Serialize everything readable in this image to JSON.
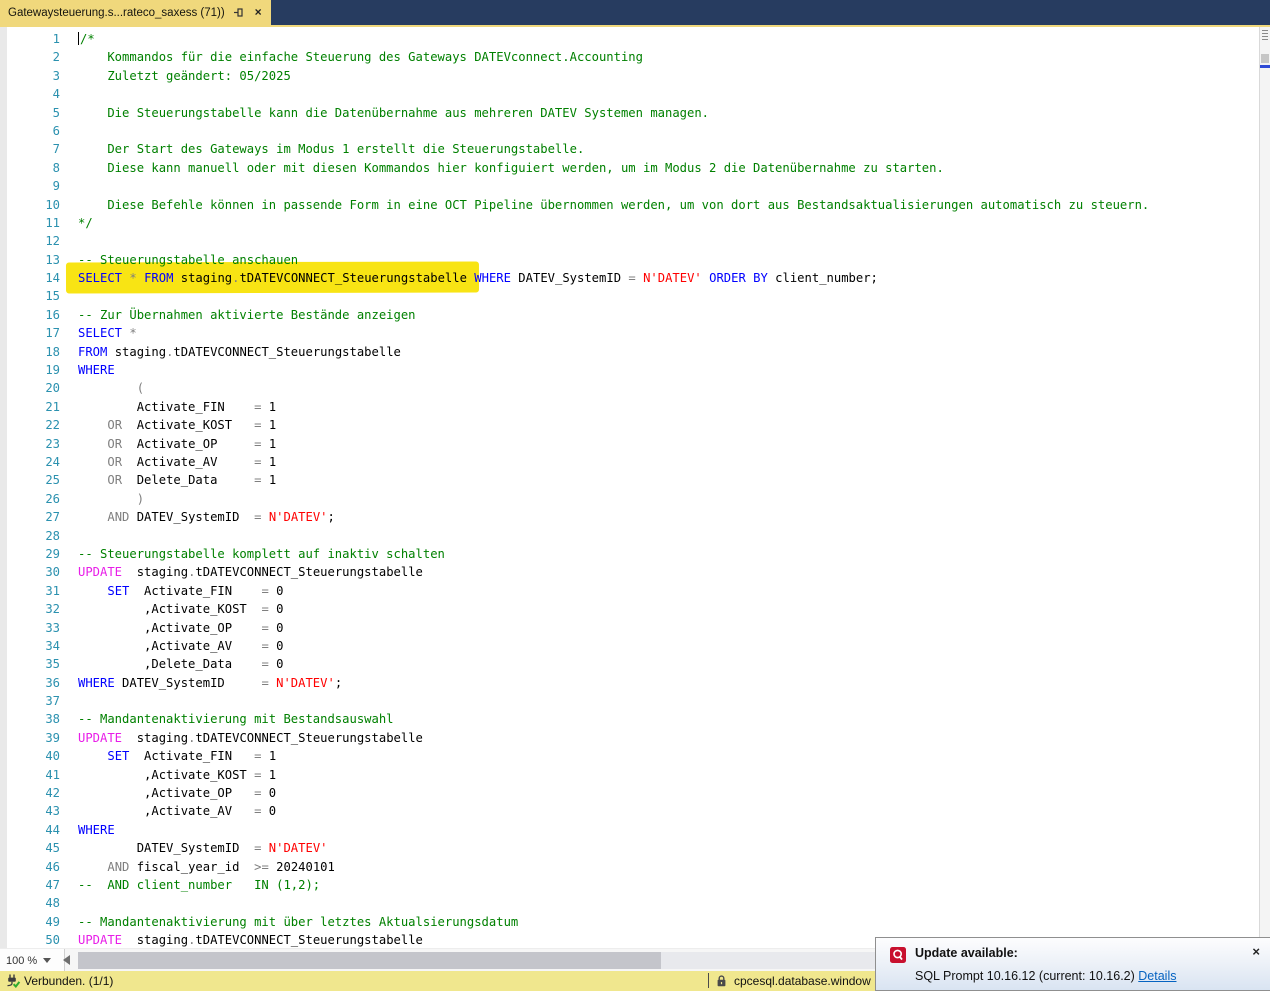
{
  "colors": {
    "navy": "#273c60",
    "tab_gold": "#f0d87c",
    "lineno": "#2b91af",
    "cm": "#008000",
    "kw": "#0000ff",
    "op": "#7f7f7f",
    "mg": "#e81ee8",
    "str": "#ff0000",
    "idc": "#000000",
    "numc": "#000000",
    "status_bg": "#f0e78e",
    "track": "#e8e9ed",
    "thumb": "#c4c5cb",
    "scrollcol": "#f4f4f4",
    "link": "#0563c1"
  },
  "tab": {
    "title": "Gatewaysteuerung.s...rateco_saxess (71))",
    "close_glyph": "×"
  },
  "icons": {
    "pin": "pushpin",
    "chevron_down": "▾",
    "scroll_left_arrow": "◀",
    "connection_plug": "plug-with-green-check",
    "lock": "padlock",
    "sql_prompt": "red-speech-bubble"
  },
  "editor": {
    "zoom_level": "100 %",
    "highlight": {
      "color": "#f8e414",
      "lines": "13-14",
      "covers": "SELECT * FROM staging.tDATEVCONNECT_Steuerungstabelle"
    },
    "lines": [
      {
        "n": 1,
        "caret": true,
        "tokens": [
          [
            "cm",
            "/*"
          ]
        ]
      },
      {
        "n": 2,
        "tokens": [
          [
            "cm",
            "    Kommandos für die einfache Steuerung des Gateways DATEVconnect.Accounting"
          ]
        ]
      },
      {
        "n": 3,
        "tokens": [
          [
            "cm",
            "    Zuletzt geändert: 05/2025"
          ]
        ]
      },
      {
        "n": 4,
        "tokens": []
      },
      {
        "n": 5,
        "tokens": [
          [
            "cm",
            "    Die Steuerungstabelle kann die Datenübernahme aus mehreren DATEV Systemen managen."
          ]
        ]
      },
      {
        "n": 6,
        "tokens": []
      },
      {
        "n": 7,
        "tokens": [
          [
            "cm",
            "    Der Start des Gateways im Modus 1 erstellt die Steuerungstabelle."
          ]
        ]
      },
      {
        "n": 8,
        "tokens": [
          [
            "cm",
            "    Diese kann manuell oder mit diesen Kommandos hier konfiguiert werden, um im Modus 2 die Datenübernahme zu starten."
          ]
        ]
      },
      {
        "n": 9,
        "tokens": []
      },
      {
        "n": 10,
        "tokens": [
          [
            "cm",
            "    Diese Befehle können in passende Form in eine OCT Pipeline übernommen werden, um von dort aus Bestandsaktualisierungen automatisch zu steuern."
          ]
        ]
      },
      {
        "n": 11,
        "tokens": [
          [
            "cm",
            "*/"
          ]
        ]
      },
      {
        "n": 12,
        "tokens": []
      },
      {
        "n": 13,
        "tokens": [
          [
            "cm",
            "-- Steuerungstabelle anschauen"
          ]
        ]
      },
      {
        "n": 14,
        "tokens": [
          [
            "kw",
            "SELECT"
          ],
          [
            "id",
            " "
          ],
          [
            "op",
            "*"
          ],
          [
            "id",
            " "
          ],
          [
            "kw",
            "FROM"
          ],
          [
            "id",
            " staging"
          ],
          [
            "op",
            "."
          ],
          [
            "id",
            "tDATEVCONNECT_Steuerungstabelle "
          ],
          [
            "kw",
            "WHERE"
          ],
          [
            "id",
            " DATEV_SystemID "
          ],
          [
            "op",
            "="
          ],
          [
            "id",
            " "
          ],
          [
            "str",
            "N'DATEV'"
          ],
          [
            "id",
            " "
          ],
          [
            "kw",
            "ORDER"
          ],
          [
            "id",
            " "
          ],
          [
            "kw",
            "BY"
          ],
          [
            "id",
            " client_number;"
          ]
        ]
      },
      {
        "n": 15,
        "tokens": []
      },
      {
        "n": 16,
        "tokens": [
          [
            "cm",
            "-- Zur Übernahmen aktivierte Bestände anzeigen"
          ]
        ]
      },
      {
        "n": 17,
        "tokens": [
          [
            "kw",
            "SELECT"
          ],
          [
            "id",
            " "
          ],
          [
            "op",
            "*"
          ]
        ]
      },
      {
        "n": 18,
        "tokens": [
          [
            "kw",
            "FROM"
          ],
          [
            "id",
            " staging"
          ],
          [
            "op",
            "."
          ],
          [
            "id",
            "tDATEVCONNECT_Steuerungstabelle"
          ]
        ]
      },
      {
        "n": 19,
        "tokens": [
          [
            "kw",
            "WHERE"
          ]
        ]
      },
      {
        "n": 20,
        "tokens": [
          [
            "id",
            "        "
          ],
          [
            "op",
            "("
          ]
        ]
      },
      {
        "n": 21,
        "tokens": [
          [
            "id",
            "        Activate_FIN    "
          ],
          [
            "op",
            "="
          ],
          [
            "id",
            " "
          ],
          [
            "num",
            "1"
          ]
        ]
      },
      {
        "n": 22,
        "tokens": [
          [
            "id",
            "    "
          ],
          [
            "op",
            "OR"
          ],
          [
            "id",
            "  Activate_KOST   "
          ],
          [
            "op",
            "="
          ],
          [
            "id",
            " "
          ],
          [
            "num",
            "1"
          ]
        ]
      },
      {
        "n": 23,
        "tokens": [
          [
            "id",
            "    "
          ],
          [
            "op",
            "OR"
          ],
          [
            "id",
            "  Activate_OP     "
          ],
          [
            "op",
            "="
          ],
          [
            "id",
            " "
          ],
          [
            "num",
            "1"
          ]
        ]
      },
      {
        "n": 24,
        "tokens": [
          [
            "id",
            "    "
          ],
          [
            "op",
            "OR"
          ],
          [
            "id",
            "  Activate_AV     "
          ],
          [
            "op",
            "="
          ],
          [
            "id",
            " "
          ],
          [
            "num",
            "1"
          ]
        ]
      },
      {
        "n": 25,
        "tokens": [
          [
            "id",
            "    "
          ],
          [
            "op",
            "OR"
          ],
          [
            "id",
            "  Delete_Data     "
          ],
          [
            "op",
            "="
          ],
          [
            "id",
            " "
          ],
          [
            "num",
            "1"
          ]
        ]
      },
      {
        "n": 26,
        "tokens": [
          [
            "id",
            "        "
          ],
          [
            "op",
            ")"
          ]
        ]
      },
      {
        "n": 27,
        "tokens": [
          [
            "id",
            "    "
          ],
          [
            "op",
            "AND"
          ],
          [
            "id",
            " DATEV_SystemID  "
          ],
          [
            "op",
            "="
          ],
          [
            "id",
            " "
          ],
          [
            "str",
            "N'DATEV'"
          ],
          [
            "id",
            ";"
          ]
        ]
      },
      {
        "n": 28,
        "tokens": []
      },
      {
        "n": 29,
        "tokens": [
          [
            "cm",
            "-- Steuerungstabelle komplett auf inaktiv schalten"
          ]
        ]
      },
      {
        "n": 30,
        "tokens": [
          [
            "mg",
            "UPDATE"
          ],
          [
            "id",
            "  staging"
          ],
          [
            "op",
            "."
          ],
          [
            "id",
            "tDATEVCONNECT_Steuerungstabelle"
          ]
        ]
      },
      {
        "n": 31,
        "tokens": [
          [
            "id",
            "    "
          ],
          [
            "kw",
            "SET"
          ],
          [
            "id",
            "  Activate_FIN    "
          ],
          [
            "op",
            "="
          ],
          [
            "id",
            " "
          ],
          [
            "num",
            "0"
          ]
        ]
      },
      {
        "n": 32,
        "tokens": [
          [
            "id",
            "         ,Activate_KOST  "
          ],
          [
            "op",
            "="
          ],
          [
            "id",
            " "
          ],
          [
            "num",
            "0"
          ]
        ]
      },
      {
        "n": 33,
        "tokens": [
          [
            "id",
            "         ,Activate_OP    "
          ],
          [
            "op",
            "="
          ],
          [
            "id",
            " "
          ],
          [
            "num",
            "0"
          ]
        ]
      },
      {
        "n": 34,
        "tokens": [
          [
            "id",
            "         ,Activate_AV    "
          ],
          [
            "op",
            "="
          ],
          [
            "id",
            " "
          ],
          [
            "num",
            "0"
          ]
        ]
      },
      {
        "n": 35,
        "tokens": [
          [
            "id",
            "         ,Delete_Data    "
          ],
          [
            "op",
            "="
          ],
          [
            "id",
            " "
          ],
          [
            "num",
            "0"
          ]
        ]
      },
      {
        "n": 36,
        "tokens": [
          [
            "kw",
            "WHERE"
          ],
          [
            "id",
            " DATEV_SystemID     "
          ],
          [
            "op",
            "="
          ],
          [
            "id",
            " "
          ],
          [
            "str",
            "N'DATEV'"
          ],
          [
            "id",
            ";"
          ]
        ]
      },
      {
        "n": 37,
        "tokens": []
      },
      {
        "n": 38,
        "tokens": [
          [
            "cm",
            "-- Mandantenaktivierung mit Bestandsauswahl"
          ]
        ]
      },
      {
        "n": 39,
        "tokens": [
          [
            "mg",
            "UPDATE"
          ],
          [
            "id",
            "  staging"
          ],
          [
            "op",
            "."
          ],
          [
            "id",
            "tDATEVCONNECT_Steuerungstabelle"
          ]
        ]
      },
      {
        "n": 40,
        "tokens": [
          [
            "id",
            "    "
          ],
          [
            "kw",
            "SET"
          ],
          [
            "id",
            "  Activate_FIN   "
          ],
          [
            "op",
            "="
          ],
          [
            "id",
            " "
          ],
          [
            "num",
            "1"
          ]
        ]
      },
      {
        "n": 41,
        "tokens": [
          [
            "id",
            "         ,Activate_KOST "
          ],
          [
            "op",
            "="
          ],
          [
            "id",
            " "
          ],
          [
            "num",
            "1"
          ]
        ]
      },
      {
        "n": 42,
        "tokens": [
          [
            "id",
            "         ,Activate_OP   "
          ],
          [
            "op",
            "="
          ],
          [
            "id",
            " "
          ],
          [
            "num",
            "0"
          ]
        ]
      },
      {
        "n": 43,
        "tokens": [
          [
            "id",
            "         ,Activate_AV   "
          ],
          [
            "op",
            "="
          ],
          [
            "id",
            " "
          ],
          [
            "num",
            "0"
          ]
        ]
      },
      {
        "n": 44,
        "tokens": [
          [
            "kw",
            "WHERE"
          ]
        ]
      },
      {
        "n": 45,
        "tokens": [
          [
            "id",
            "        DATEV_SystemID  "
          ],
          [
            "op",
            "="
          ],
          [
            "id",
            " "
          ],
          [
            "str",
            "N'DATEV'"
          ]
        ]
      },
      {
        "n": 46,
        "tokens": [
          [
            "id",
            "    "
          ],
          [
            "op",
            "AND"
          ],
          [
            "id",
            " fiscal_year_id  "
          ],
          [
            "op",
            ">="
          ],
          [
            "id",
            " "
          ],
          [
            "num",
            "20240101"
          ]
        ]
      },
      {
        "n": 47,
        "tokens": [
          [
            "cm",
            "--  AND client_number   IN (1,2);"
          ]
        ]
      },
      {
        "n": 48,
        "tokens": []
      },
      {
        "n": 49,
        "tokens": [
          [
            "cm",
            "-- Mandantenaktivierung mit über letztes Aktualsierungsdatum"
          ]
        ]
      },
      {
        "n": 50,
        "tokens": [
          [
            "mg",
            "UPDATE"
          ],
          [
            "id",
            "  staging"
          ],
          [
            "op",
            "."
          ],
          [
            "id",
            "tDATEVCONNECT_Steuerungstabelle"
          ]
        ]
      }
    ]
  },
  "statusbar": {
    "connection": "Verbunden. (1/1)",
    "server": "cpcesql.database.window"
  },
  "notification": {
    "title": "Update available:",
    "message": "SQL Prompt 10.16.12 (current: 10.16.2)",
    "link": "Details",
    "close_glyph": "×"
  }
}
